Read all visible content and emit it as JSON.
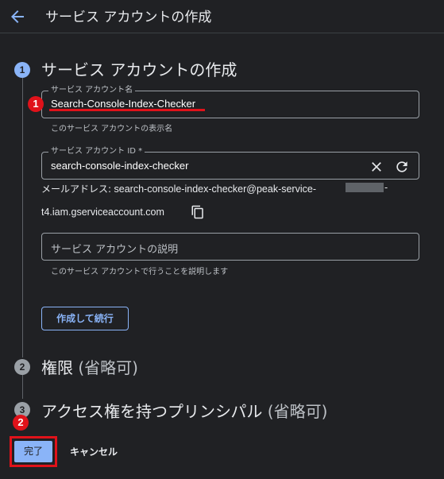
{
  "header": {
    "title": "サービス アカウントの作成"
  },
  "steps": [
    {
      "number": "1",
      "title": "サービス アカウントの作成",
      "optional": ""
    },
    {
      "number": "2",
      "title": "権限",
      "optional": "(省略可)"
    },
    {
      "number": "3",
      "title": "アクセス権を持つプリンシパル",
      "optional": "(省略可)"
    }
  ],
  "form": {
    "name_label": "サービス アカウント名",
    "name_value": "Search-Console-Index-Checker",
    "name_hint": "このサービス アカウントの表示名",
    "id_label": "サービス アカウント ID *",
    "id_value": "search-console-index-checker",
    "email_prefix": "メールアドレス:",
    "email_line1": "search-console-index-checker@peak-service-",
    "email_line1_tail": "-",
    "email_line2": "t4.iam.gserviceaccount.com",
    "description_placeholder": "サービス アカウントの説明",
    "description_hint": "このサービス アカウントで行うことを説明します",
    "create_button": "作成して続行"
  },
  "footer": {
    "done_button": "完了",
    "cancel_button": "キャンセル"
  },
  "annotations": {
    "marker1": "1",
    "marker2": "2"
  },
  "colors": {
    "background": "#202124",
    "accent": "#8ab4f8",
    "annotation_red": "#e0121a"
  }
}
